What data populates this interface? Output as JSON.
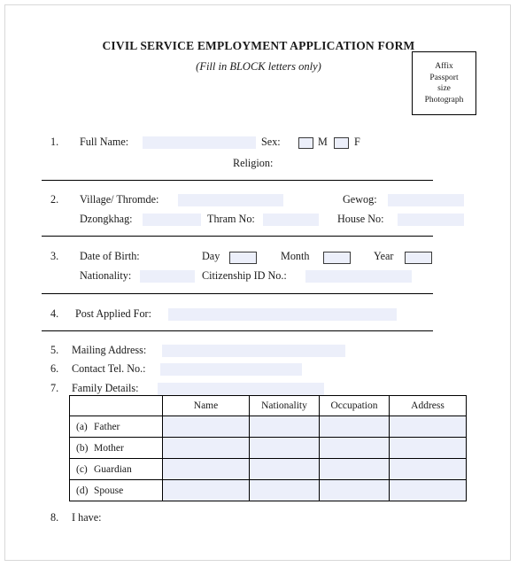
{
  "header": {
    "title": "CIVIL SERVICE EMPLOYMENT APPLICATION FORM",
    "subtitle": "(Fill in BLOCK letters only)",
    "photo_box": {
      "line1": "Affix",
      "line2": "Passport",
      "line3": "size",
      "line4": "Photograph"
    }
  },
  "colors": {
    "field_fill": "#eceffa",
    "page_border": "#d8d8d8",
    "rule": "#000000",
    "text": "#1a1a1a"
  },
  "items": {
    "item1": {
      "number": "1.",
      "full_name_label": "Full Name:",
      "full_name_value": "",
      "sex_label": "Sex:",
      "sex_male_label": "M",
      "sex_female_label": "F",
      "religion_label": "Religion:",
      "religion_value": ""
    },
    "item2": {
      "number": "2.",
      "village_label": "Village/ Thromde:",
      "village_value": "",
      "gewog_label": "Gewog:",
      "gewog_value": "",
      "dzongkhag_label": "Dzongkhag:",
      "dzongkhag_value": "",
      "thram_label": "Thram No:",
      "thram_value": "",
      "house_label": "House No:",
      "house_value": ""
    },
    "item3": {
      "number": "3.",
      "dob_label": "Date of Birth:",
      "day_label": "Day",
      "day_value": "",
      "month_label": "Month",
      "month_value": "",
      "year_label": "Year",
      "year_value": "",
      "nationality_label": "Nationality:",
      "nationality_value": "",
      "citizenship_label": "Citizenship ID No.:",
      "citizenship_value": ""
    },
    "item4": {
      "number": "4.",
      "post_label": "Post Applied For:",
      "post_value": ""
    },
    "item5": {
      "number": "5.",
      "mailing_label": "Mailing Address:",
      "mailing_value": ""
    },
    "item6": {
      "number": "6.",
      "tel_label": "Contact Tel. No.:",
      "tel_value": ""
    },
    "item7": {
      "number": "7.",
      "family_label": "Family Details:",
      "family_value": ""
    },
    "item8": {
      "number": "8.",
      "have_label": "I have:"
    }
  },
  "family_table": {
    "headers": [
      "",
      "Name",
      "Nationality",
      "Occupation",
      "Address"
    ],
    "rows": [
      {
        "mark": "(a)",
        "label": "Father",
        "name": "",
        "nationality": "",
        "occupation": "",
        "address": ""
      },
      {
        "mark": "(b)",
        "label": "Mother",
        "name": "",
        "nationality": "",
        "occupation": "",
        "address": ""
      },
      {
        "mark": "(c)",
        "label": "Guardian",
        "name": "",
        "nationality": "",
        "occupation": "",
        "address": ""
      },
      {
        "mark": "(d)",
        "label": "Spouse",
        "name": "",
        "nationality": "",
        "occupation": "",
        "address": ""
      }
    ]
  }
}
